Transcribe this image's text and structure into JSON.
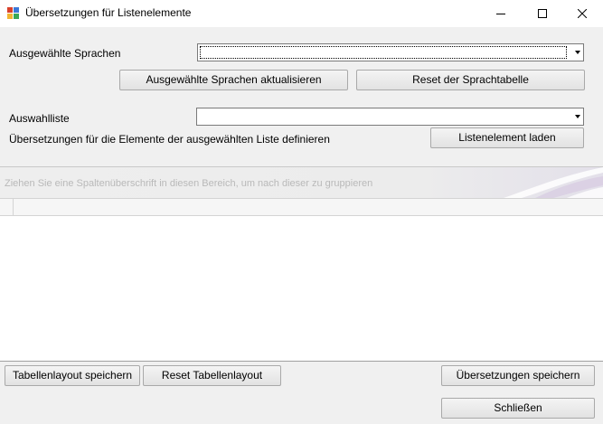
{
  "window": {
    "title": "Übersetzungen für Listenelemente",
    "controls": {
      "minimize_icon": "minimize-icon",
      "maximize_icon": "maximize-icon",
      "close_icon": "close-icon"
    }
  },
  "languages": {
    "label": "Ausgewählte Sprachen",
    "selected_value": "",
    "update_button": "Ausgewählte Sprachen aktualisieren",
    "reset_button": "Reset der Sprachtabelle"
  },
  "selection_list": {
    "label": "Auswahlliste",
    "selected_value": "",
    "define_text": "Übersetzungen für die Elemente der ausgewählten Liste definieren",
    "load_button": "Listenelement laden"
  },
  "grid": {
    "group_panel_text": "Ziehen Sie eine Spaltenüberschrift in diesen Bereich, um nach dieser zu gruppieren"
  },
  "footer": {
    "save_layout_button": "Tabellenlayout speichern",
    "reset_layout_button": "Reset Tabellenlayout",
    "save_translations_button": "Übersetzungen speichern",
    "close_button": "Schließen"
  }
}
